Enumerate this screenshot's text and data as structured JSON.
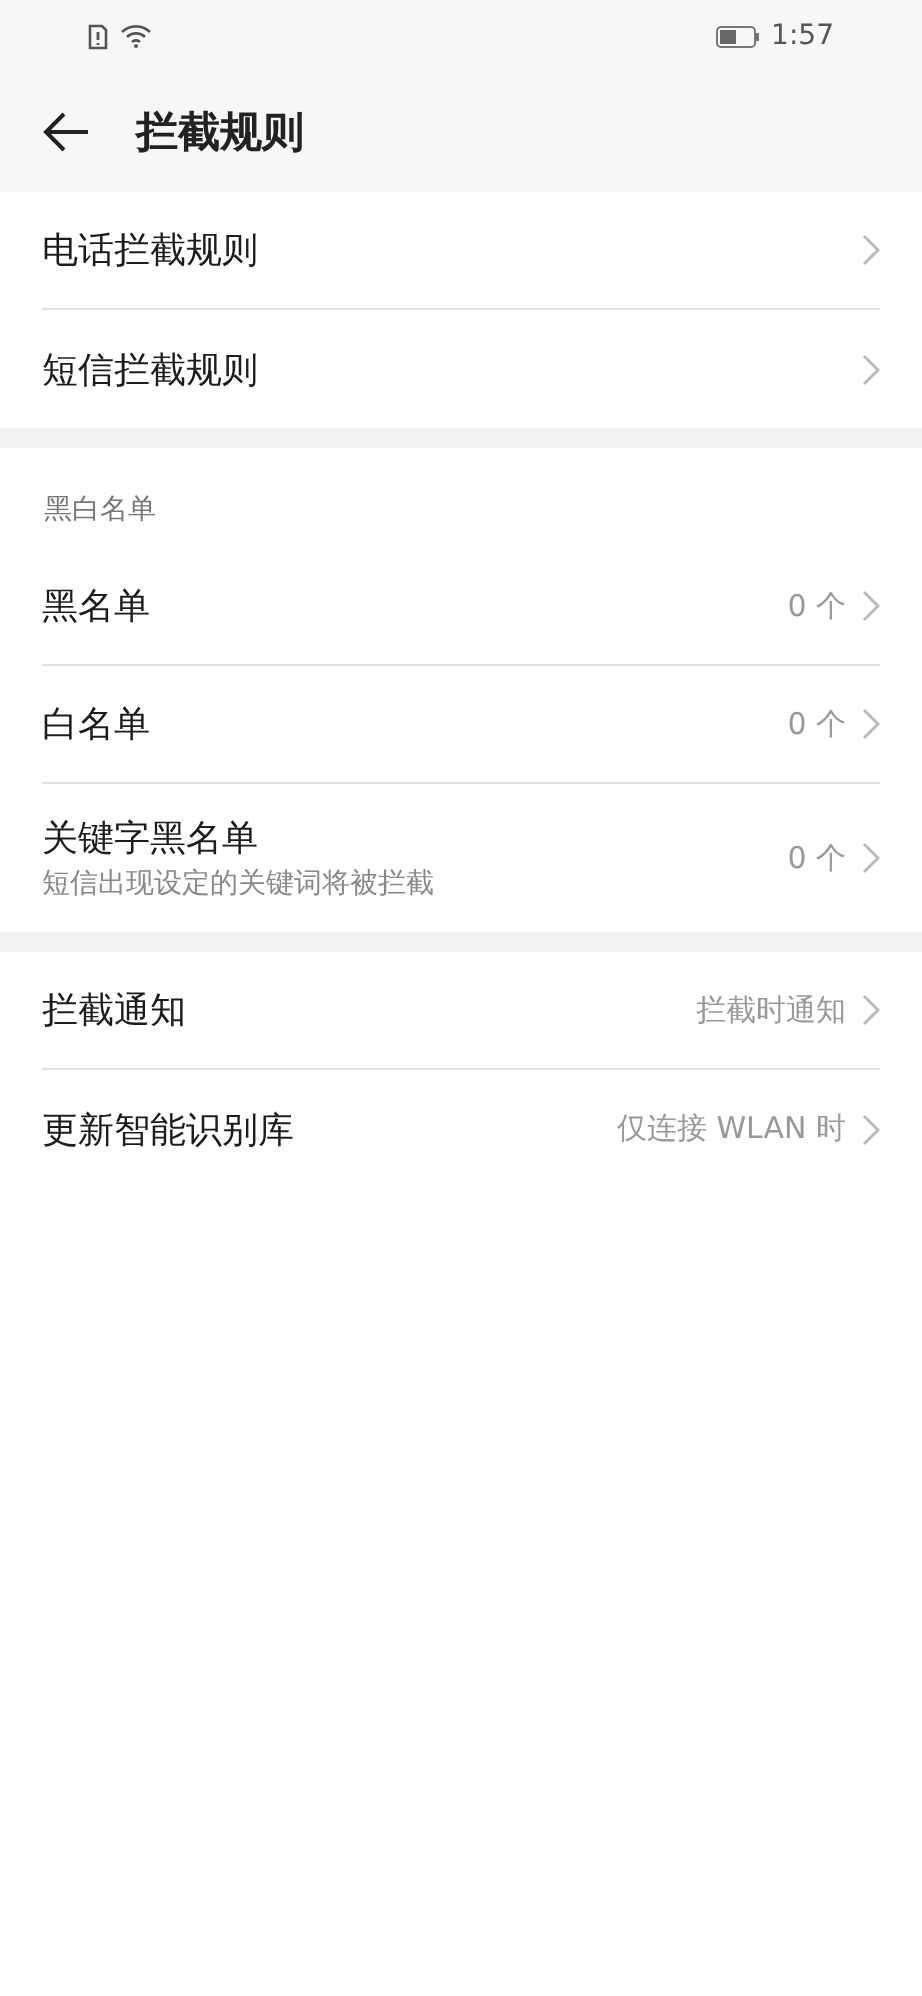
{
  "status_bar": {
    "time": "1:57"
  },
  "header": {
    "title": "拦截规则"
  },
  "sections": [
    {
      "rows": [
        {
          "title": "电话拦截规则"
        },
        {
          "title": "短信拦截规则"
        }
      ]
    },
    {
      "heading": "黑白名单",
      "rows": [
        {
          "title": "黑名单",
          "value": "0 个"
        },
        {
          "title": "白名单",
          "value": "0 个"
        },
        {
          "title": "关键字黑名单",
          "subtitle": "短信出现设定的关键词将被拦截",
          "value": "0 个"
        }
      ]
    },
    {
      "rows": [
        {
          "title": "拦截通知",
          "value": "拦截时通知"
        },
        {
          "title": "更新智能识别库",
          "value": "仅连接 WLAN 时"
        }
      ]
    }
  ]
}
